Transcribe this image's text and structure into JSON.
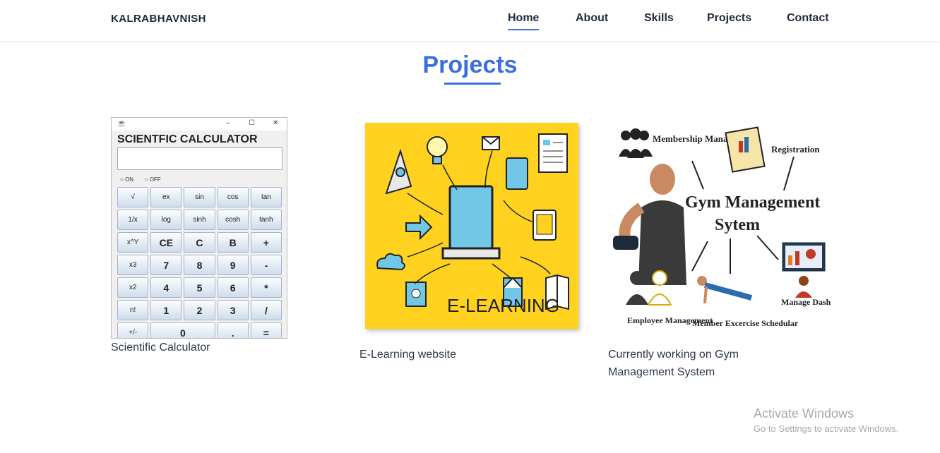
{
  "nav": {
    "brand": "KALRABHAVNISH",
    "links": [
      {
        "label": "Home",
        "active": true
      },
      {
        "label": "About"
      },
      {
        "label": "Skills"
      },
      {
        "label": "Projects"
      },
      {
        "label": "Contact"
      }
    ]
  },
  "section": {
    "title": "Projects"
  },
  "projects": [
    {
      "caption": "Scientific Calculator",
      "image": {
        "heading": "SCIENTFIC CALCULATOR",
        "radio_on": "ON",
        "radio_off": "OFF",
        "keys": [
          "√",
          "ex",
          "sin",
          "cos",
          "tan",
          "1/x",
          "log",
          "sinh",
          "cosh",
          "tanh",
          "x^Y",
          "CE",
          "C",
          "B",
          "+",
          "x3",
          "7",
          "8",
          "9",
          "-",
          "x2",
          "4",
          "5",
          "6",
          "*",
          "n!",
          "1",
          "2",
          "3",
          "/",
          "+/-",
          "0",
          ".",
          "="
        ]
      }
    },
    {
      "caption": "E-Learning website",
      "image": {
        "text": "E-LEARNING",
        "accent": "#ffd21f"
      }
    },
    {
      "caption": "Currently working on Gym Management System",
      "image": {
        "title_line1": "Gym Management",
        "title_line2": "Sytem",
        "membership": "Membership Management",
        "registration": "Registration",
        "employee": "Employee Management",
        "member_schedular": "Member Excercise Schedular",
        "dashboard": "Manage Dashboard"
      }
    }
  ],
  "watermark": {
    "line1": "Activate Windows",
    "line2": "Go to Settings to activate Windows."
  },
  "colors": {
    "accent": "#3b6fe0"
  }
}
